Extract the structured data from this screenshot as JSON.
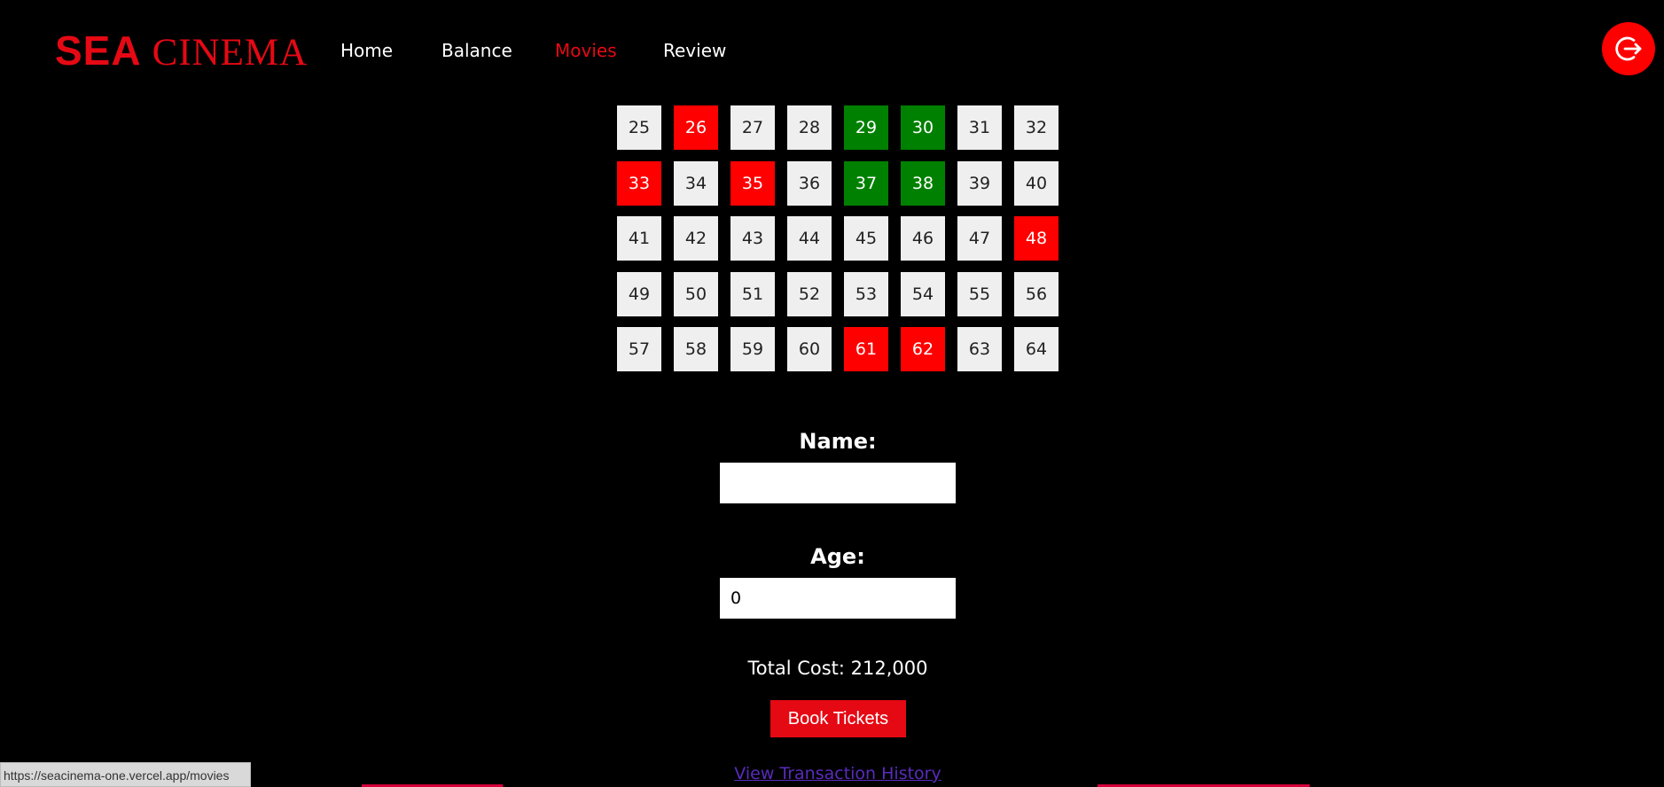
{
  "header": {
    "logo_sea": "SEA",
    "logo_cinema": "CINEMA",
    "nav": [
      {
        "label": "Home",
        "active": false
      },
      {
        "label": "Balance",
        "active": false
      },
      {
        "label": "Movies",
        "active": true
      },
      {
        "label": "Review",
        "active": false
      }
    ],
    "logout_icon": "logout-icon"
  },
  "seats": [
    {
      "n": "25",
      "s": "available"
    },
    {
      "n": "26",
      "s": "booked"
    },
    {
      "n": "27",
      "s": "available"
    },
    {
      "n": "28",
      "s": "available"
    },
    {
      "n": "29",
      "s": "selected"
    },
    {
      "n": "30",
      "s": "selected"
    },
    {
      "n": "31",
      "s": "available"
    },
    {
      "n": "32",
      "s": "available"
    },
    {
      "n": "33",
      "s": "booked"
    },
    {
      "n": "34",
      "s": "available"
    },
    {
      "n": "35",
      "s": "booked"
    },
    {
      "n": "36",
      "s": "available"
    },
    {
      "n": "37",
      "s": "selected"
    },
    {
      "n": "38",
      "s": "selected"
    },
    {
      "n": "39",
      "s": "available"
    },
    {
      "n": "40",
      "s": "available"
    },
    {
      "n": "41",
      "s": "available"
    },
    {
      "n": "42",
      "s": "available"
    },
    {
      "n": "43",
      "s": "available"
    },
    {
      "n": "44",
      "s": "available"
    },
    {
      "n": "45",
      "s": "available"
    },
    {
      "n": "46",
      "s": "available"
    },
    {
      "n": "47",
      "s": "available"
    },
    {
      "n": "48",
      "s": "booked"
    },
    {
      "n": "49",
      "s": "available"
    },
    {
      "n": "50",
      "s": "available"
    },
    {
      "n": "51",
      "s": "available"
    },
    {
      "n": "52",
      "s": "available"
    },
    {
      "n": "53",
      "s": "available"
    },
    {
      "n": "54",
      "s": "available"
    },
    {
      "n": "55",
      "s": "available"
    },
    {
      "n": "56",
      "s": "available"
    },
    {
      "n": "57",
      "s": "available"
    },
    {
      "n": "58",
      "s": "available"
    },
    {
      "n": "59",
      "s": "available"
    },
    {
      "n": "60",
      "s": "available"
    },
    {
      "n": "61",
      "s": "booked"
    },
    {
      "n": "62",
      "s": "booked"
    },
    {
      "n": "63",
      "s": "available"
    },
    {
      "n": "64",
      "s": "available"
    }
  ],
  "form": {
    "name_label": "Name:",
    "name_value": "",
    "age_label": "Age:",
    "age_value": "0",
    "total_cost": "Total Cost: 212,000",
    "book_button": "Book Tickets",
    "history_link": "View Transaction History"
  },
  "status_bar": {
    "url": "https://seacinema-one.vercel.app/movies"
  },
  "colors": {
    "brand_red": "#e50914",
    "booked": "#ff0000",
    "selected": "#008000",
    "available": "#efefef"
  }
}
